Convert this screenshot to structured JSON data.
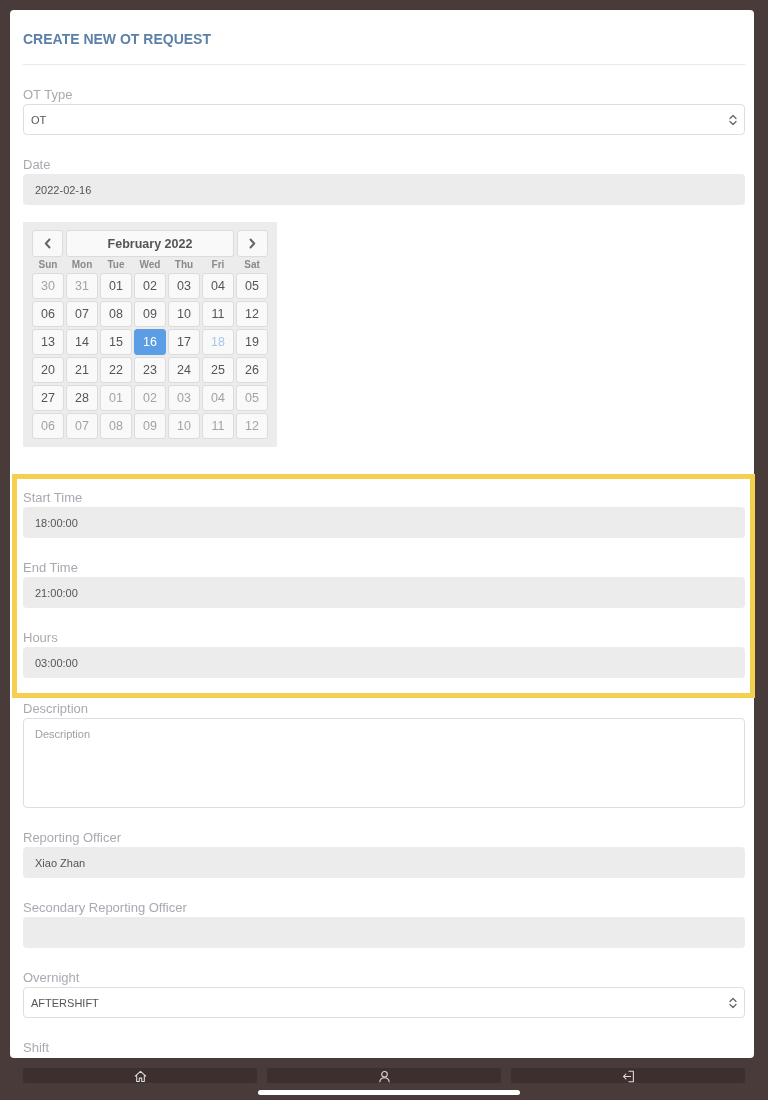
{
  "title": "CREATE NEW OT REQUEST",
  "sections": [
    {
      "highlighted": false,
      "fields": [
        {
          "kind": "select",
          "label": "OT Type",
          "value": "OT"
        },
        {
          "kind": "readonly",
          "label": "Date",
          "value": "2022-02-16"
        },
        {
          "kind": "calendar",
          "month": "February 2022",
          "weekdays": [
            "Sun",
            "Mon",
            "Tue",
            "Wed",
            "Thu",
            "Fri",
            "Sat"
          ],
          "days": [
            {
              "text": "30",
              "other_month": true,
              "disabled": false,
              "selected": false
            },
            {
              "text": "31",
              "other_month": true,
              "disabled": false,
              "selected": false
            },
            {
              "text": "01",
              "other_month": false,
              "disabled": false,
              "selected": false
            },
            {
              "text": "02",
              "other_month": false,
              "disabled": false,
              "selected": false
            },
            {
              "text": "03",
              "other_month": false,
              "disabled": false,
              "selected": false
            },
            {
              "text": "04",
              "other_month": false,
              "disabled": false,
              "selected": false
            },
            {
              "text": "05",
              "other_month": false,
              "disabled": false,
              "selected": false
            },
            {
              "text": "06",
              "other_month": false,
              "disabled": false,
              "selected": false
            },
            {
              "text": "07",
              "other_month": false,
              "disabled": false,
              "selected": false
            },
            {
              "text": "08",
              "other_month": false,
              "disabled": false,
              "selected": false
            },
            {
              "text": "09",
              "other_month": false,
              "disabled": false,
              "selected": false
            },
            {
              "text": "10",
              "other_month": false,
              "disabled": false,
              "selected": false
            },
            {
              "text": "11",
              "other_month": false,
              "disabled": false,
              "selected": false
            },
            {
              "text": "12",
              "other_month": false,
              "disabled": false,
              "selected": false
            },
            {
              "text": "13",
              "other_month": false,
              "disabled": false,
              "selected": false
            },
            {
              "text": "14",
              "other_month": false,
              "disabled": false,
              "selected": false
            },
            {
              "text": "15",
              "other_month": false,
              "disabled": false,
              "selected": false
            },
            {
              "text": "16",
              "other_month": false,
              "disabled": false,
              "selected": true
            },
            {
              "text": "17",
              "other_month": false,
              "disabled": false,
              "selected": false
            },
            {
              "text": "18",
              "other_month": false,
              "disabled": true,
              "selected": false
            },
            {
              "text": "19",
              "other_month": false,
              "disabled": false,
              "selected": false
            },
            {
              "text": "20",
              "other_month": false,
              "disabled": false,
              "selected": false
            },
            {
              "text": "21",
              "other_month": false,
              "disabled": false,
              "selected": false
            },
            {
              "text": "22",
              "other_month": false,
              "disabled": false,
              "selected": false
            },
            {
              "text": "23",
              "other_month": false,
              "disabled": false,
              "selected": false
            },
            {
              "text": "24",
              "other_month": false,
              "disabled": false,
              "selected": false
            },
            {
              "text": "25",
              "other_month": false,
              "disabled": false,
              "selected": false
            },
            {
              "text": "26",
              "other_month": false,
              "disabled": false,
              "selected": false
            },
            {
              "text": "27",
              "other_month": false,
              "disabled": false,
              "selected": false
            },
            {
              "text": "28",
              "other_month": false,
              "disabled": false,
              "selected": false
            },
            {
              "text": "01",
              "other_month": true,
              "disabled": false,
              "selected": false
            },
            {
              "text": "02",
              "other_month": true,
              "disabled": false,
              "selected": false
            },
            {
              "text": "03",
              "other_month": true,
              "disabled": false,
              "selected": false
            },
            {
              "text": "04",
              "other_month": true,
              "disabled": false,
              "selected": false
            },
            {
              "text": "05",
              "other_month": true,
              "disabled": false,
              "selected": false
            },
            {
              "text": "06",
              "other_month": true,
              "disabled": false,
              "selected": false
            },
            {
              "text": "07",
              "other_month": true,
              "disabled": false,
              "selected": false
            },
            {
              "text": "08",
              "other_month": true,
              "disabled": false,
              "selected": false
            },
            {
              "text": "09",
              "other_month": true,
              "disabled": false,
              "selected": false
            },
            {
              "text": "10",
              "other_month": true,
              "disabled": false,
              "selected": false
            },
            {
              "text": "11",
              "other_month": true,
              "disabled": false,
              "selected": false
            },
            {
              "text": "12",
              "other_month": true,
              "disabled": false,
              "selected": false
            }
          ]
        }
      ]
    },
    {
      "highlighted": true,
      "fields": [
        {
          "kind": "readonly",
          "label": "Start Time",
          "value": "18:00:00"
        },
        {
          "kind": "readonly",
          "label": "End Time",
          "value": "21:00:00"
        },
        {
          "kind": "readonly",
          "label": "Hours",
          "value": "03:00:00"
        }
      ]
    },
    {
      "highlighted": false,
      "fields": [
        {
          "kind": "textarea",
          "label": "Description",
          "placeholder": "Description"
        },
        {
          "kind": "readonly",
          "label": "Reporting Officer",
          "value": "Xiao Zhan"
        },
        {
          "kind": "readonly",
          "label": "Secondary Reporting Officer"
        },
        {
          "kind": "select",
          "label": "Overnight",
          "value": "AFTERSHIFT"
        },
        {
          "kind": "label",
          "label": "Shift"
        }
      ]
    }
  ],
  "bottom_nav": [
    {
      "kind": "home"
    },
    {
      "kind": "profile"
    },
    {
      "kind": "exit"
    }
  ]
}
